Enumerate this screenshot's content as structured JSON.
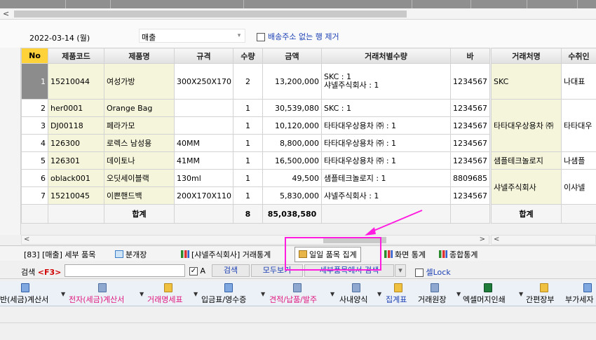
{
  "filter": {
    "date": "2022-03-14 (월)",
    "type_value": "매출",
    "exclude_no_address_label": "배송주소 없는 행 제거"
  },
  "main_grid": {
    "headers": [
      "No",
      "제품코드",
      "제품명",
      "규격",
      "수량",
      "금액",
      "거래처별수량",
      "바"
    ],
    "rows": [
      {
        "no": "1",
        "code": "15210044",
        "name": "여성가방",
        "spec": "300X250X170",
        "qty": "2",
        "amount": "13,200,000",
        "partner_qty_1": "SKC : 1",
        "partner_qty_2": "샤넬주식회사 : 1",
        "barcode": "1234567"
      },
      {
        "no": "2",
        "code": "her0001",
        "name": "Orange Bag",
        "spec": "",
        "qty": "1",
        "amount": "30,539,080",
        "partner_qty_1": "SKC : 1",
        "partner_qty_2": "",
        "barcode": "1234567"
      },
      {
        "no": "3",
        "code": "DJ00118",
        "name": "페라가모",
        "spec": "",
        "qty": "1",
        "amount": "10,120,000",
        "partner_qty_1": "타타대우상용차 ㈜ : 1",
        "partner_qty_2": "",
        "barcode": "1234567"
      },
      {
        "no": "4",
        "code": "126300",
        "name": "로렉스 남성용",
        "spec": "40MM",
        "qty": "1",
        "amount": "8,800,000",
        "partner_qty_1": "타타대우상용차 ㈜ : 1",
        "partner_qty_2": "",
        "barcode": "1234567"
      },
      {
        "no": "5",
        "code": "126301",
        "name": "데이토나",
        "spec": "41MM",
        "qty": "1",
        "amount": "16,500,000",
        "partner_qty_1": "타타대우상용차 ㈜ : 1",
        "partner_qty_2": "",
        "barcode": "1234567"
      },
      {
        "no": "6",
        "code": "oblack001",
        "name": "오딧세이블랙",
        "spec": "130ml",
        "qty": "1",
        "amount": "49,500",
        "partner_qty_1": "샘플테크놀로지 : 1",
        "partner_qty_2": "",
        "barcode": "8809685"
      },
      {
        "no": "7",
        "code": "15210045",
        "name": "이쁜핸드백",
        "spec": "200X170X110",
        "qty": "1",
        "amount": "5,830,000",
        "partner_qty_1": "샤넬주식회사 : 1",
        "partner_qty_2": "",
        "barcode": "1234567"
      }
    ],
    "total_label": "합계",
    "total_qty": "8",
    "total_amount": "85,038,580"
  },
  "side_grid": {
    "headers": [
      "거래처명",
      "수취인"
    ],
    "groups": [
      {
        "partner": "SKC",
        "receiver": "나대표"
      },
      {
        "partner": "타타대우상용차 ㈜",
        "receiver": "타타대우"
      },
      {
        "partner": "샘플테크놀로지",
        "receiver": "나샘플"
      },
      {
        "partner": "샤넬주식회사",
        "receiver": "이샤넬"
      }
    ],
    "total_label": "합계"
  },
  "tabs": {
    "detail": "[83] [매출] 세부 품목",
    "split": "분개장",
    "partner_stats": "[샤넬주식회사] 거래통계",
    "daily_summary": "일일 품목 집계",
    "screen_stats": "화면 통계",
    "total_stats": "종합통계"
  },
  "search": {
    "label": "검색",
    "key": "<F3>",
    "check_a": "A",
    "search_btn": "검색",
    "show_all_btn": "모두보기",
    "detail_search_btn": "세부품목에서 검색",
    "cell_lock": "셀Lock"
  },
  "toolbar": {
    "items": [
      "반(세금)계산서",
      "전자(세금)계산서",
      "거래명세표",
      "입금표/영수증",
      "견적/납품/발주",
      "사내양식",
      "집계표",
      "거래원장",
      "엑셀머지인쇄",
      "간편장부",
      "부가세자"
    ]
  },
  "colors": {
    "highlight": "#ff1ee0",
    "header_no": "#ffd23a",
    "link_blue": "#1a3fb4",
    "pink": "#e0167e"
  }
}
